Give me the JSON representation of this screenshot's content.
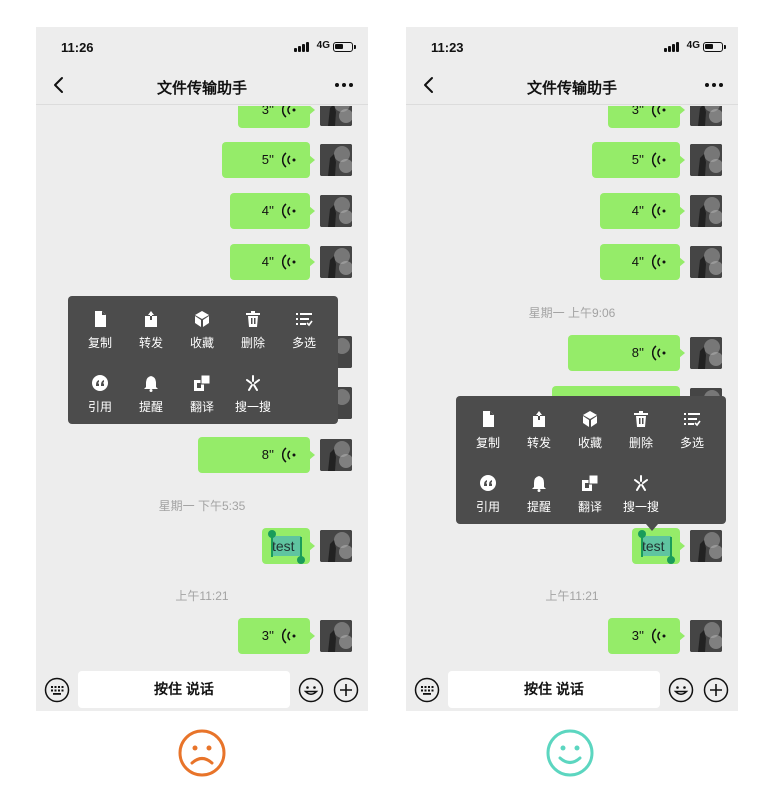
{
  "left_phone": {
    "status": {
      "time": "11:26",
      "network": "4G"
    },
    "title": "文件传输助手",
    "voice_messages": [
      "3''",
      "5''",
      "4''",
      "4''",
      "8''",
      "3''"
    ],
    "timestamps": [
      "星期一 下午5:35",
      "上午11:21"
    ],
    "text_message": "test",
    "context_menu": {
      "row1": [
        "复制",
        "转发",
        "收藏",
        "删除",
        "多选"
      ],
      "row2": [
        "引用",
        "提醒",
        "翻译",
        "搜一搜"
      ]
    },
    "input": {
      "talk_label": "按住 说话"
    }
  },
  "right_phone": {
    "status": {
      "time": "11:23",
      "network": "4G"
    },
    "title": "文件传输助手",
    "voice_messages": [
      "3''",
      "5''",
      "4''",
      "4''",
      "8''",
      "3''"
    ],
    "timestamps": [
      "星期一 上午9:06",
      "上午11:21"
    ],
    "text_message": "test",
    "context_menu": {
      "row1": [
        "复制",
        "转发",
        "收藏",
        "删除",
        "多选"
      ],
      "row2": [
        "引用",
        "提醒",
        "翻译",
        "搜一搜"
      ]
    },
    "input": {
      "talk_label": "按住 说话"
    }
  },
  "icons": {
    "back": "chevron-left-icon",
    "more": "ellipsis-icon",
    "voice": "voice-wave-icon",
    "copy": "document-icon",
    "forward": "share-icon",
    "favorite": "cube-icon",
    "delete": "trash-icon",
    "multi_select": "list-check-icon",
    "quote": "quote-icon",
    "remind": "bell-icon",
    "translate": "translate-icon",
    "search": "sparkle-icon",
    "keyboard": "keyboard-icon",
    "emoji": "emoji-icon",
    "plus": "plus-circle-icon",
    "sad_face": "sad-face-icon",
    "happy_face": "happy-face-icon"
  },
  "colors": {
    "bubble": "#95ec69",
    "menu_bg": "#4c4c4c",
    "chat_bg": "#ededed",
    "selection": "#5fc4a0",
    "handle": "#1a9c5a",
    "sad_face": "#e8742a",
    "happy_face": "#5cd6c0"
  }
}
